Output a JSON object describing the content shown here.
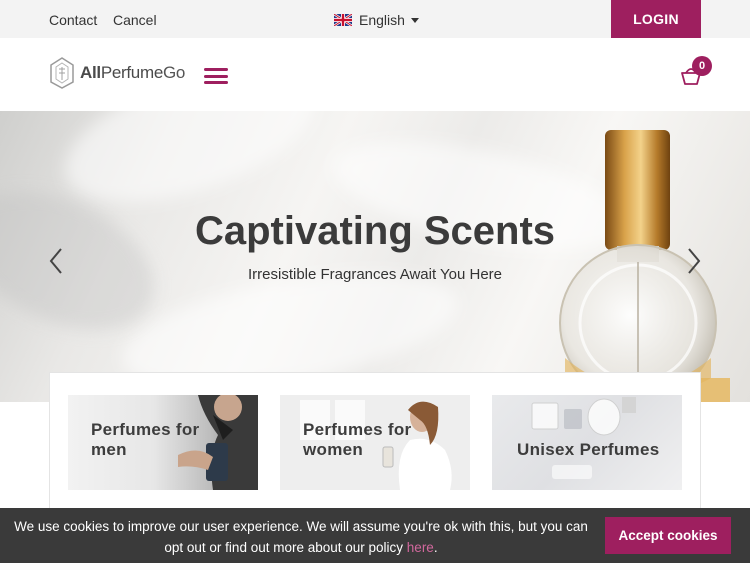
{
  "topbar": {
    "contact_label": "Contact",
    "cancel_label": "Cancel",
    "language_label": "English",
    "login_label": "LOGIN"
  },
  "header": {
    "logo_bold": "All",
    "logo_mid": "Perfume",
    "logo_light": "Go",
    "cart_count": "0"
  },
  "hero": {
    "title": "Captivating Scents",
    "subtitle": "Irresistible Fragrances Await You Here"
  },
  "categories": [
    {
      "label_line1": "Perfumes for",
      "label_line2": "men"
    },
    {
      "label_line1": "Perfumes for",
      "label_line2": "women"
    },
    {
      "label_line1": "Unisex Perfumes",
      "label_line2": ""
    }
  ],
  "cookie": {
    "text_line1": "We use cookies to improve our user experience. We will assume you're ok with this, but you can",
    "text_line2": "opt out or find out more about our policy ",
    "link_label": "here",
    "text_end": ".",
    "accept_label": "Accept cookies"
  },
  "colors": {
    "brand": "#9e1f5f",
    "cookie_bg": "#3a3a3a",
    "topbar_bg": "#f3f3f3"
  },
  "icons": [
    "uk-flag-icon",
    "caret-down-icon",
    "logo-icon",
    "hamburger-icon",
    "basket-icon",
    "chevron-left-icon",
    "chevron-right-icon"
  ]
}
